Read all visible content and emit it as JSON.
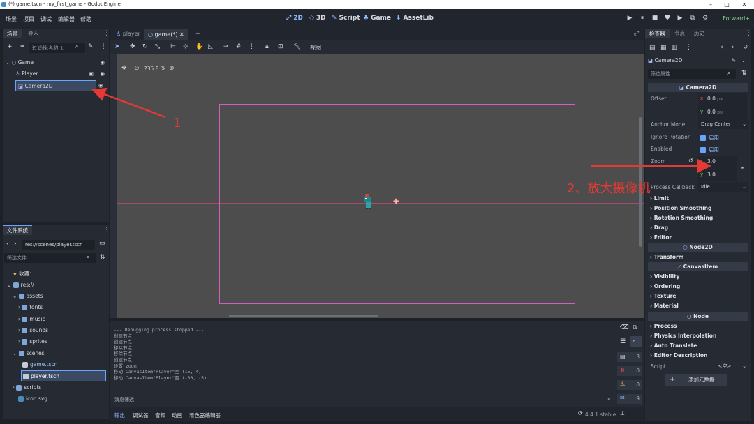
{
  "window": {
    "title": "(*) game.tscn - my_first_game - Godot Engine",
    "minimize": "–",
    "maximize": "□",
    "close": "✕"
  },
  "menu": [
    "场景",
    "项目",
    "调试",
    "编辑器",
    "帮助"
  ],
  "workspaces": [
    "2D",
    "3D",
    "Script",
    "Game",
    "AssetLib"
  ],
  "play_buttons": [
    "▶",
    "⏸",
    "■",
    "⛊",
    "▶",
    "⧉",
    "⚙"
  ],
  "renderer": "Forward+",
  "scene_panel": {
    "tabs": [
      "场景",
      "导入"
    ],
    "filter_placeholder": "过滤器:名称, t",
    "nodes": [
      {
        "name": "Game",
        "icon": "node2d-icon"
      },
      {
        "name": "Player",
        "icon": "character-icon"
      },
      {
        "name": "Camera2D",
        "icon": "camera-icon"
      }
    ]
  },
  "fs_panel": {
    "tab": "文件系统",
    "path": "res://scenes/player.tscn",
    "filter": "筛选文件",
    "items": [
      "收藏：",
      "res://",
      "assets",
      "fonts",
      "music",
      "sounds",
      "sprites",
      "scenes",
      "game.tscn",
      "player.tscn",
      "scripts",
      "icon.svg"
    ]
  },
  "editor": {
    "tabs": [
      "player",
      "game(*)"
    ],
    "view_menu": "视图",
    "zoom": "235.8 %"
  },
  "console": {
    "lines": [
      "--- Debugging process stopped ---",
      "创建节点",
      "创建节点",
      "移除节点",
      "移除节点",
      "创建节点",
      "设置 zoom",
      "移动 CanvasItem\"Player\"至 (15, 4)",
      "移动 CanvasItem\"Player\"至 (-30, -5)"
    ],
    "filter": "消息筛选",
    "counts": [
      "3",
      "0",
      "0",
      "9"
    ],
    "bottom_tabs": [
      "输出",
      "调试器",
      "音频",
      "动画",
      "着色器编辑器"
    ],
    "version": "4.4.1.stable"
  },
  "inspector": {
    "tabs": [
      "检查器",
      "节点",
      "历史"
    ],
    "node": "Camera2D",
    "filter": "筛选属性",
    "section": "Camera2D",
    "offset_label": "Offset",
    "offset_x": "0.0",
    "offset_y": "0.0",
    "px": "px",
    "anchor_label": "Anchor Mode",
    "anchor_value": "Drag Center",
    "ignore_rot_label": "Ignore Rotation",
    "enabled_label": "Enabled",
    "on_text": "启用",
    "zoom_label": "Zoom",
    "zoom_x": "3.0",
    "zoom_y": "3.0",
    "process_label": "Process Callback",
    "process_value": "Idle",
    "groups1": [
      "Limit",
      "Position Smoothing",
      "Rotation Smoothing",
      "Drag",
      "Editor"
    ],
    "section2": "Node2D",
    "groups2": [
      "Transform"
    ],
    "section3": "CanvasItem",
    "groups3": [
      "Visibility",
      "Ordering",
      "Texture",
      "Material"
    ],
    "section4": "Node",
    "groups4": [
      "Process",
      "Physics Interpolation",
      "Auto Translate",
      "Editor Description"
    ],
    "script_label": "Script",
    "script_value": "<空>",
    "add_meta": "添加元数据"
  },
  "annotations": {
    "a1": "1",
    "a2": "2、放大摄像机",
    "color": "#e53935"
  }
}
